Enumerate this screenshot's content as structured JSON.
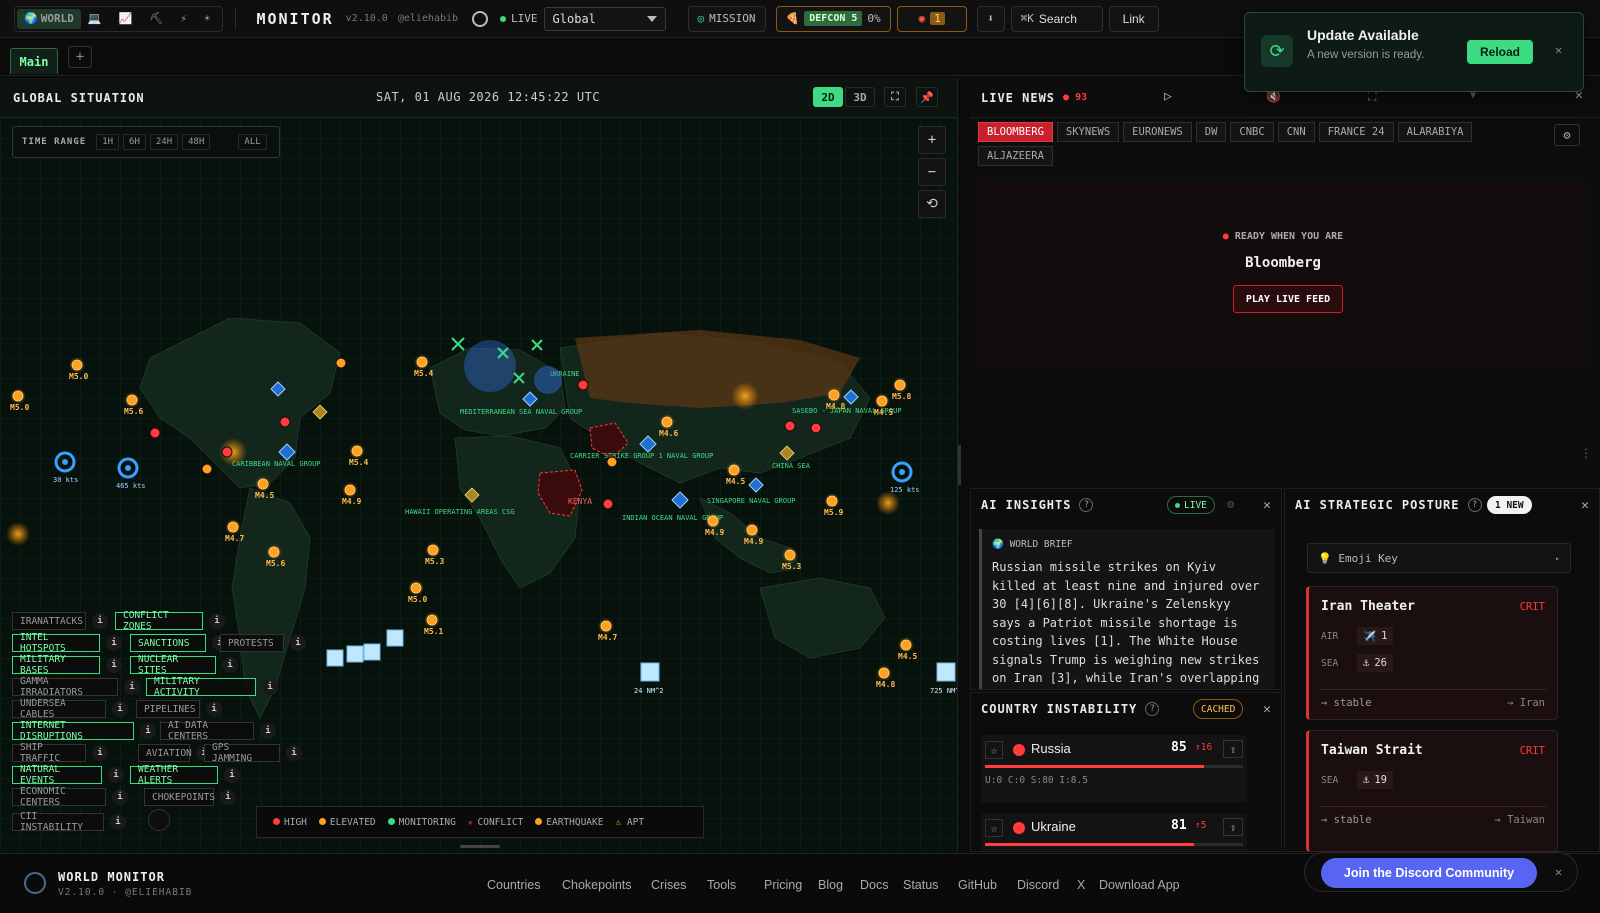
{
  "topbar": {
    "variants": [
      {
        "icon": "🌍",
        "label": "WORLD"
      },
      {
        "icon": "💻",
        "label": ""
      },
      {
        "icon": "📈",
        "label": ""
      },
      {
        "icon": "⛏",
        "label": ""
      },
      {
        "icon": "⚡",
        "label": ""
      },
      {
        "icon": "☀",
        "label": ""
      }
    ],
    "brand": "MONITOR",
    "version": "v2.10.0",
    "author": "@eliehabib",
    "live_label": "LIVE",
    "region_value": "Global",
    "mission_label": "MISSION",
    "defcon_label": "DEFCON 5",
    "defcon_percent": "0%",
    "alert_count": "1",
    "search_kbd": "⌘K",
    "search_label": "Search",
    "link_label": "Link"
  },
  "tabs": {
    "main_label": "Main",
    "add_label": "+"
  },
  "map": {
    "title": "GLOBAL SITUATION",
    "datetime": "SAT, 01 AUG 2026 12:45:22 UTC",
    "mode_2d": "2D",
    "mode_3d": "3D",
    "time_range_label": "TIME RANGE",
    "time_ranges": [
      "1H",
      "6H",
      "24H",
      "48H",
      "ALL"
    ],
    "zoom_in": "+",
    "zoom_out": "−",
    "reset": "⟲",
    "labels": {
      "med": "MEDITERRANEAN SEA NAVAL GROUP",
      "carrier": "CARRIER STRIKE GROUP 1 NAVAL GROUP",
      "sasebo": "SASEBO - JAPAN NAVAL GROUP",
      "indian": "INDIAN OCEAN NAVAL GROUP",
      "singapore": "SINGAPORE NAVAL GROUP",
      "hawaii": "HAWAII OPERATING AREAS CSG",
      "caribbean": "CARIBBEAN NAVAL GROUP",
      "kenya": "KENYA",
      "china": "CHINA SEA",
      "ukraine": "UKRAINE"
    },
    "quakes": [
      {
        "t": "M5.0"
      },
      {
        "t": "M5.0"
      },
      {
        "t": "M5.6"
      },
      {
        "t": "M5.4"
      },
      {
        "t": "M5.4"
      },
      {
        "t": "M4.9"
      },
      {
        "t": "M4.7"
      },
      {
        "t": "M4.5"
      },
      {
        "t": "M5.6"
      },
      {
        "t": "M5.3"
      },
      {
        "t": "M5.0"
      },
      {
        "t": "M5.1"
      },
      {
        "t": "M4.7"
      },
      {
        "t": "M4.9"
      },
      {
        "t": "M4.8"
      },
      {
        "t": "M5.8"
      },
      {
        "t": "M4.5"
      },
      {
        "t": "M5.9"
      },
      {
        "t": "M5.3"
      },
      {
        "t": "M4.5"
      },
      {
        "t": "M4.8"
      },
      {
        "t": "M4.6"
      },
      {
        "t": "M4.9"
      },
      {
        "t": "M4.5"
      }
    ],
    "storms": [
      {
        "t": "30 kts"
      },
      {
        "t": "465 kts"
      },
      {
        "t": "125 kts"
      }
    ],
    "ice": [
      {
        "t": "24 NM^2"
      },
      {
        "t": "725 NM^2"
      }
    ],
    "layers": [
      {
        "label": "IRANATTACKS",
        "on": false
      },
      {
        "label": "CONFLICT ZONES",
        "on": true
      },
      {
        "label": "INTEL HOTSPOTS",
        "on": true
      },
      {
        "label": "SANCTIONS",
        "on": true
      },
      {
        "label": "PROTESTS",
        "on": false
      },
      {
        "label": "MILITARY BASES",
        "on": true
      },
      {
        "label": "NUCLEAR SITES",
        "on": true
      },
      {
        "label": "GAMMA IRRADIATORS",
        "on": false
      },
      {
        "label": "MILITARY ACTIVITY",
        "on": true
      },
      {
        "label": "UNDERSEA CABLES",
        "on": false
      },
      {
        "label": "PIPELINES",
        "on": false
      },
      {
        "label": "INTERNET DISRUPTIONS",
        "on": true
      },
      {
        "label": "AI DATA CENTERS",
        "on": false
      },
      {
        "label": "SHIP TRAFFIC",
        "on": false
      },
      {
        "label": "AVIATION",
        "on": false
      },
      {
        "label": "GPS JAMMING",
        "on": false
      },
      {
        "label": "NATURAL EVENTS",
        "on": true
      },
      {
        "label": "WEATHER ALERTS",
        "on": true
      },
      {
        "label": "ECONOMIC CENTERS",
        "on": false
      },
      {
        "label": "CHOKEPOINTS",
        "on": false
      },
      {
        "label": "CII INSTABILITY",
        "on": false
      }
    ],
    "info_glyph": "i",
    "legend": [
      {
        "label": "HIGH",
        "color": "#ff3b3b"
      },
      {
        "label": "ELEVATED",
        "color": "#ffa021"
      },
      {
        "label": "MONITORING",
        "color": "#3ddc84"
      },
      {
        "label": "CONFLICT",
        "color": "#ff3b3b"
      },
      {
        "label": "EARTHQUAKE",
        "color": "#ffa021"
      },
      {
        "label": "APT",
        "color": "#ffa021"
      }
    ]
  },
  "news": {
    "title": "LIVE NEWS",
    "count": "93",
    "channels": [
      "BLOOMBERG",
      "SKYNEWS",
      "EURONEWS",
      "DW",
      "CNBC",
      "CNN",
      "FRANCE 24",
      "ALARABIYA",
      "ALJAZEERA"
    ],
    "ready_label": "READY WHEN YOU ARE",
    "channel_name": "Bloomberg",
    "play_label": "PLAY LIVE FEED"
  },
  "insights": {
    "title": "AI INSIGHTS",
    "badge": "LIVE",
    "brief_label": "WORLD BRIEF",
    "brief_text": "Russian missile strikes on Kyiv killed at least nine and injured over 30 [4][6][8]. Ukraine's Zelenskyy says a Patriot missile shortage is costing lives [1]. The White House signals Trump is weighing new strikes on Iran [3], while Iran's overlapping"
  },
  "posture": {
    "title": "AI STRATEGIC POSTURE",
    "badge": "1 NEW",
    "emoji_key": "Emoji Key",
    "theaters": [
      {
        "name": "Iran Theater",
        "level": "CRIT",
        "rows": [
          {
            "k": "AIR",
            "icon": "✈️",
            "v": "1"
          },
          {
            "k": "SEA",
            "icon": "⚓",
            "v": "26"
          }
        ],
        "trend": "→ stable",
        "target": "→ Iran"
      },
      {
        "name": "Taiwan Strait",
        "level": "CRIT",
        "rows": [
          {
            "k": "SEA",
            "icon": "⚓",
            "v": "19"
          }
        ],
        "trend": "→ stable",
        "target": "→ Taiwan"
      }
    ]
  },
  "instability": {
    "title": "COUNTRY INSTABILITY",
    "badge": "CACHED",
    "rows": [
      {
        "country": "Russia",
        "score": "85",
        "delta": "↑16",
        "bar": 0.85,
        "meta": "U:0 C:0 S:80 I:8.5"
      },
      {
        "country": "Ukraine",
        "score": "81",
        "delta": "↑5",
        "bar": 0.81,
        "meta": ""
      }
    ]
  },
  "footer": {
    "brand": "WORLD MONITOR",
    "sub": "V2.10.0 · @ELIEHABIB",
    "links": [
      "Countries",
      "Chokepoints",
      "Crises",
      "Tools",
      "Pricing",
      "Blog",
      "Docs",
      "Status",
      "GitHub",
      "Discord",
      "X",
      "Download App"
    ]
  },
  "toast": {
    "title": "Update Available",
    "body": "A new version is ready.",
    "reload_label": "Reload"
  },
  "discord": {
    "label": "Join the Discord Community"
  },
  "colors": {
    "accent": "#3ddc84",
    "crit": "#ff3b3b",
    "quake": "#ffa021"
  }
}
